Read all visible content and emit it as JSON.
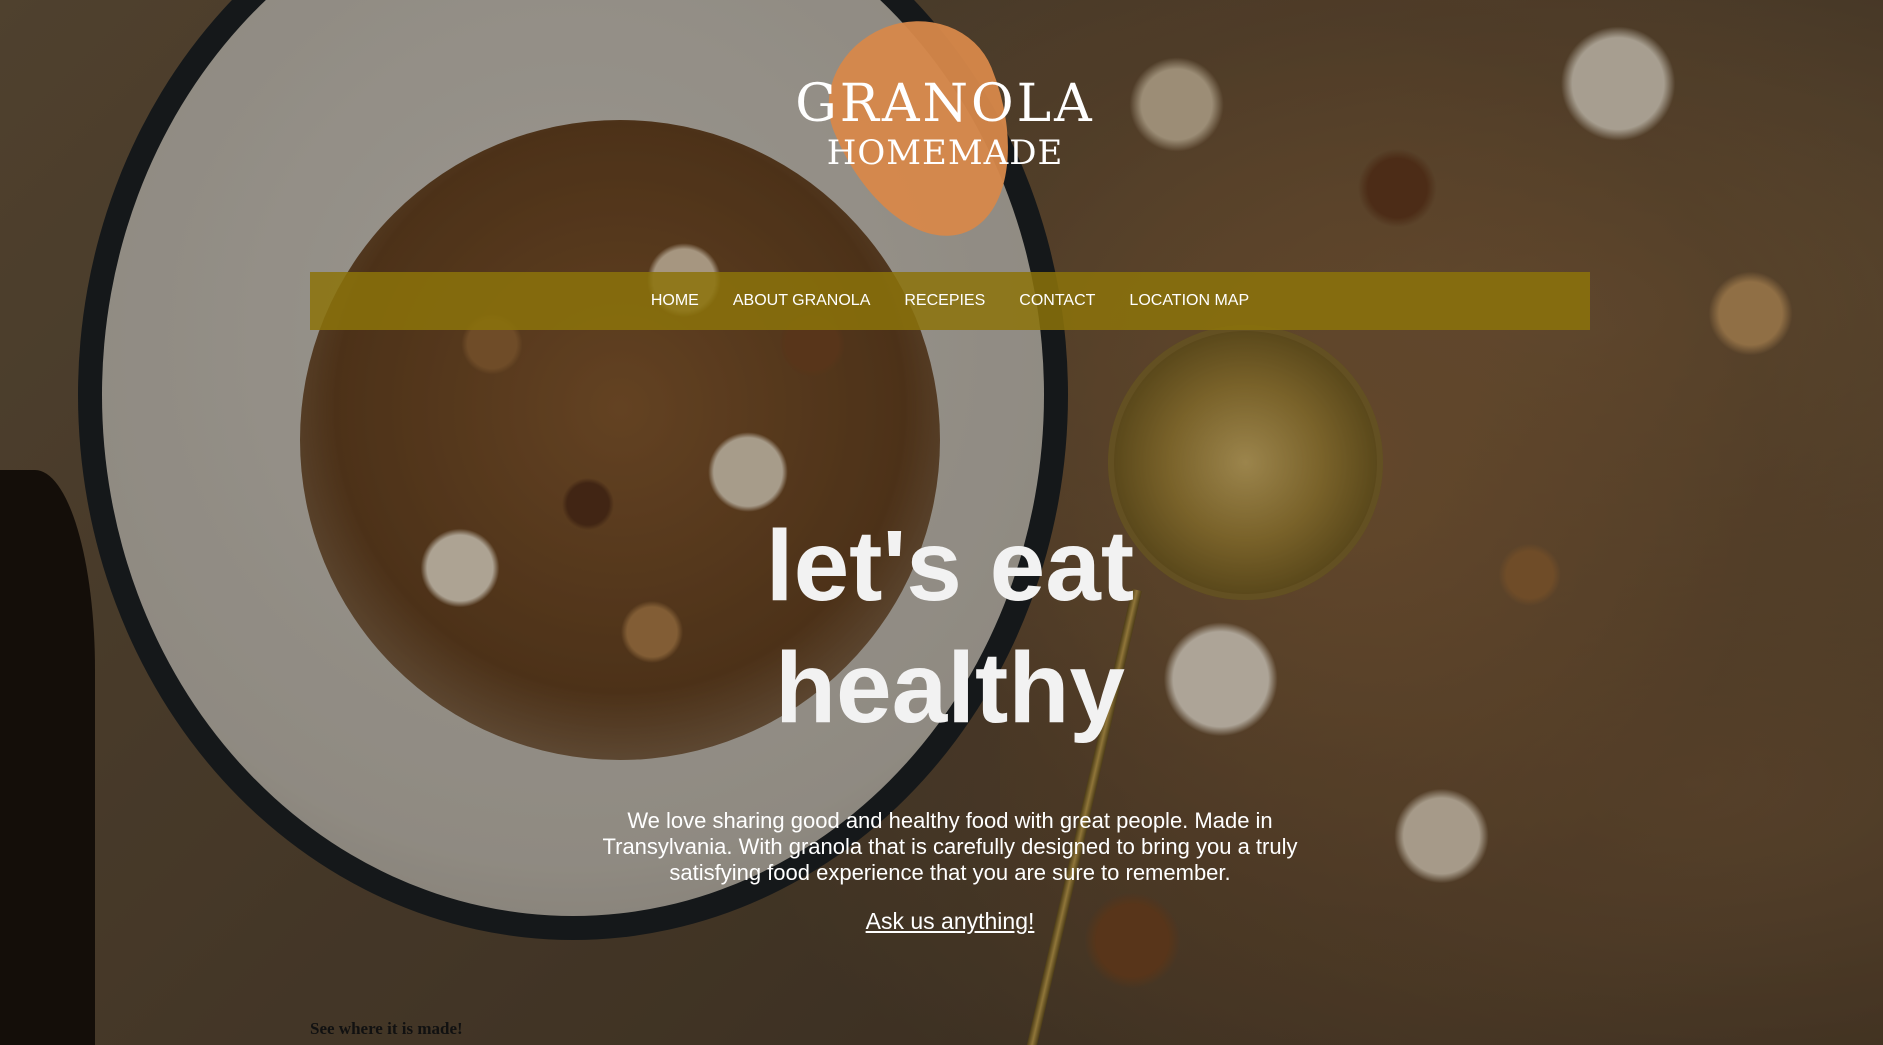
{
  "logo": {
    "title": "GRANOLA",
    "subtitle": "HOMEMADE",
    "accent_color": "#d7884a"
  },
  "nav": {
    "background_color": "#8c730a",
    "items": [
      {
        "label": "HOME"
      },
      {
        "label": "ABOUT GRANOLA"
      },
      {
        "label": "RECEPIES"
      },
      {
        "label": "CONTACT"
      },
      {
        "label": "LOCATION MAP"
      }
    ]
  },
  "hero": {
    "title_line1": "let's eat",
    "title_line2": "healthy",
    "description": "We love sharing good and healthy food with great people. Made in Transylvania. With granola that is carefully designed to bring you a truly satisfying food experience that you are sure to remember.",
    "cta_label": "Ask us anything!"
  },
  "footer": {
    "note": "See where it is made!"
  }
}
